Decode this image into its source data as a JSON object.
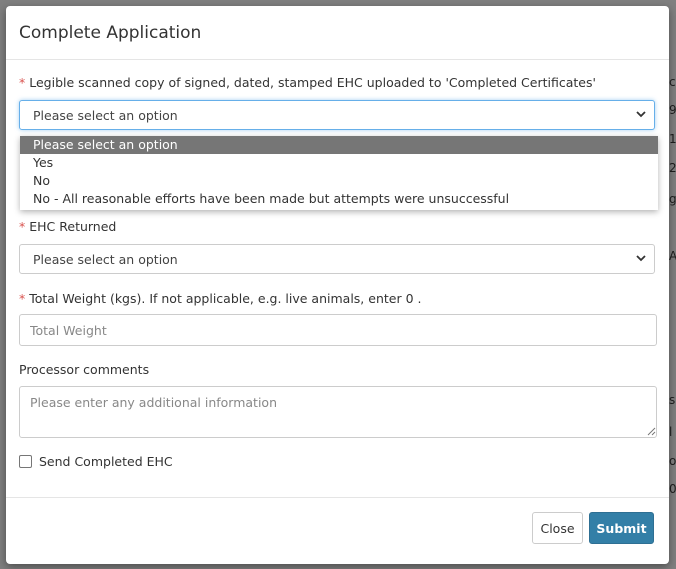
{
  "modal": {
    "title": "Complete Application",
    "fields": {
      "legible_copy": {
        "label": "Legible scanned copy of signed, dated, stamped EHC uploaded to 'Completed Certificates'",
        "value": "Please select an option",
        "options": [
          "Please select an option",
          "Yes",
          "No",
          "No - All reasonable efforts have been made but attempts were unsuccessful"
        ]
      },
      "ehc_returned": {
        "label": "EHC Returned",
        "value": "Please select an option"
      },
      "total_weight": {
        "label": "Total Weight (kgs). If not applicable, e.g. live animals, enter 0 .",
        "placeholder": "Total Weight"
      },
      "processor_comments": {
        "label": "Processor comments",
        "placeholder": "Please enter any additional information"
      },
      "send_completed": {
        "label": "Send Completed EHC",
        "checked": false
      }
    },
    "buttons": {
      "close": "Close",
      "submit": "Submit"
    }
  },
  "background_fragments": [
    "ch",
    "9",
    "1",
    "2",
    "g",
    "A",
    "s",
    "l",
    "o",
    "0"
  ],
  "colors": {
    "required": "#d9534f",
    "submit": "#337fa7",
    "selected_option": "#767676",
    "overlay": "#7f7f7f"
  },
  "icons": {
    "select_chevron": "chevron-down-icon",
    "textarea_resize": "resize-grip-icon"
  }
}
